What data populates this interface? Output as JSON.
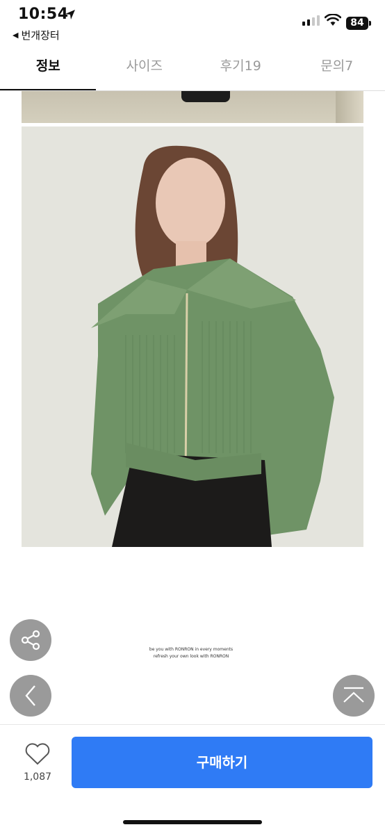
{
  "status_bar": {
    "time": "10:54",
    "battery": "84"
  },
  "back_app": {
    "label": "번개장터"
  },
  "tabs": [
    {
      "label": "정보",
      "active": true
    },
    {
      "label": "사이즈",
      "active": false
    },
    {
      "label": "후기19",
      "active": false
    },
    {
      "label": "문의7",
      "active": false
    }
  ],
  "caption": {
    "line1": "be you with RONRON in every moments",
    "line2": "refresh your own look with RONRON"
  },
  "floating": {
    "share_icon": "share-icon",
    "prev_icon": "chevron-left-icon",
    "top_icon": "scroll-top-icon"
  },
  "bottom": {
    "like_count": "1,087",
    "buy_label": "구매하기"
  },
  "colors": {
    "accent": "#2f7bf5",
    "sweater": "#6f9366"
  }
}
